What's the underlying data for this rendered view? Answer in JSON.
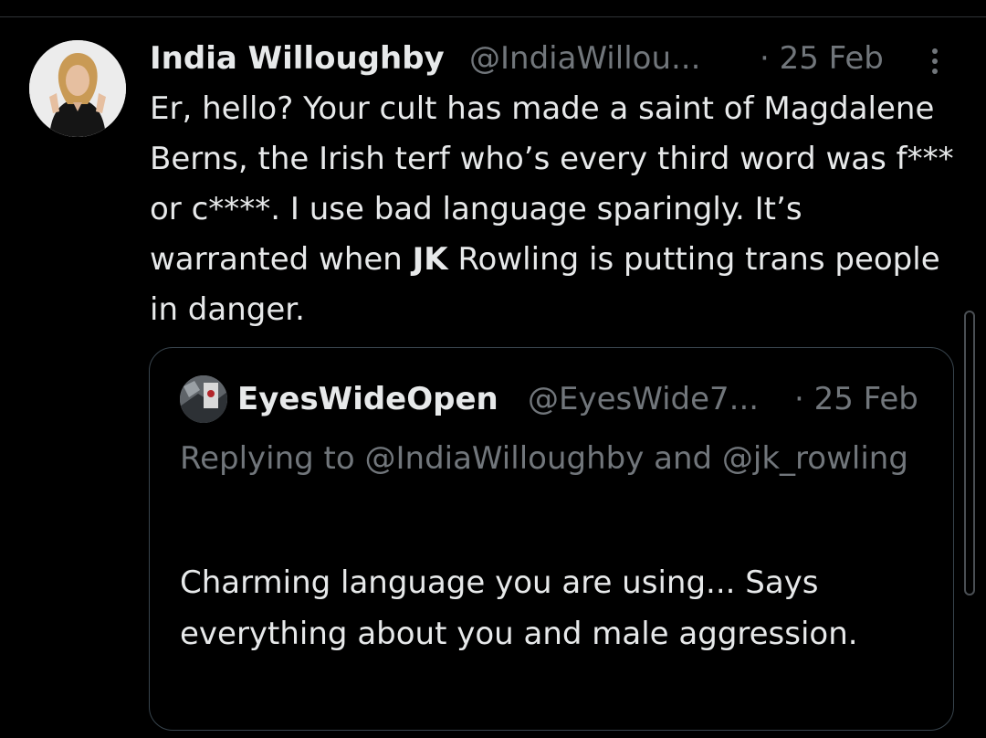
{
  "tweet": {
    "author": {
      "display_name": "India Willoughby",
      "handle": "@IndiaWillou...",
      "avatar_icon": "profile-photo"
    },
    "timestamp": "· 25 Feb",
    "more_icon": "more-vertical-icon",
    "text": {
      "part1": "Er, hello? Your cult has made a saint of Magdalene Berns, the Irish terf who’s every third word was f*** or c****. I use bad language sparingly. It’s warranted when ",
      "bold": "JK",
      "part2": " Rowling is putting trans people in danger."
    }
  },
  "quoted_tweet": {
    "author": {
      "display_name": "EyesWideOpen",
      "handle": "@EyesWide7...",
      "avatar_icon": "profile-photo"
    },
    "timestamp": "· 25 Feb",
    "replying_to": "Replying to @IndiaWilloughby and @jk_rowling",
    "text": "Charming language you are using...  Says everything about you and male aggression."
  },
  "colors": {
    "background": "#000000",
    "primary_text": "#e7e9ea",
    "secondary_text": "#71767b",
    "border": "#38444d"
  }
}
